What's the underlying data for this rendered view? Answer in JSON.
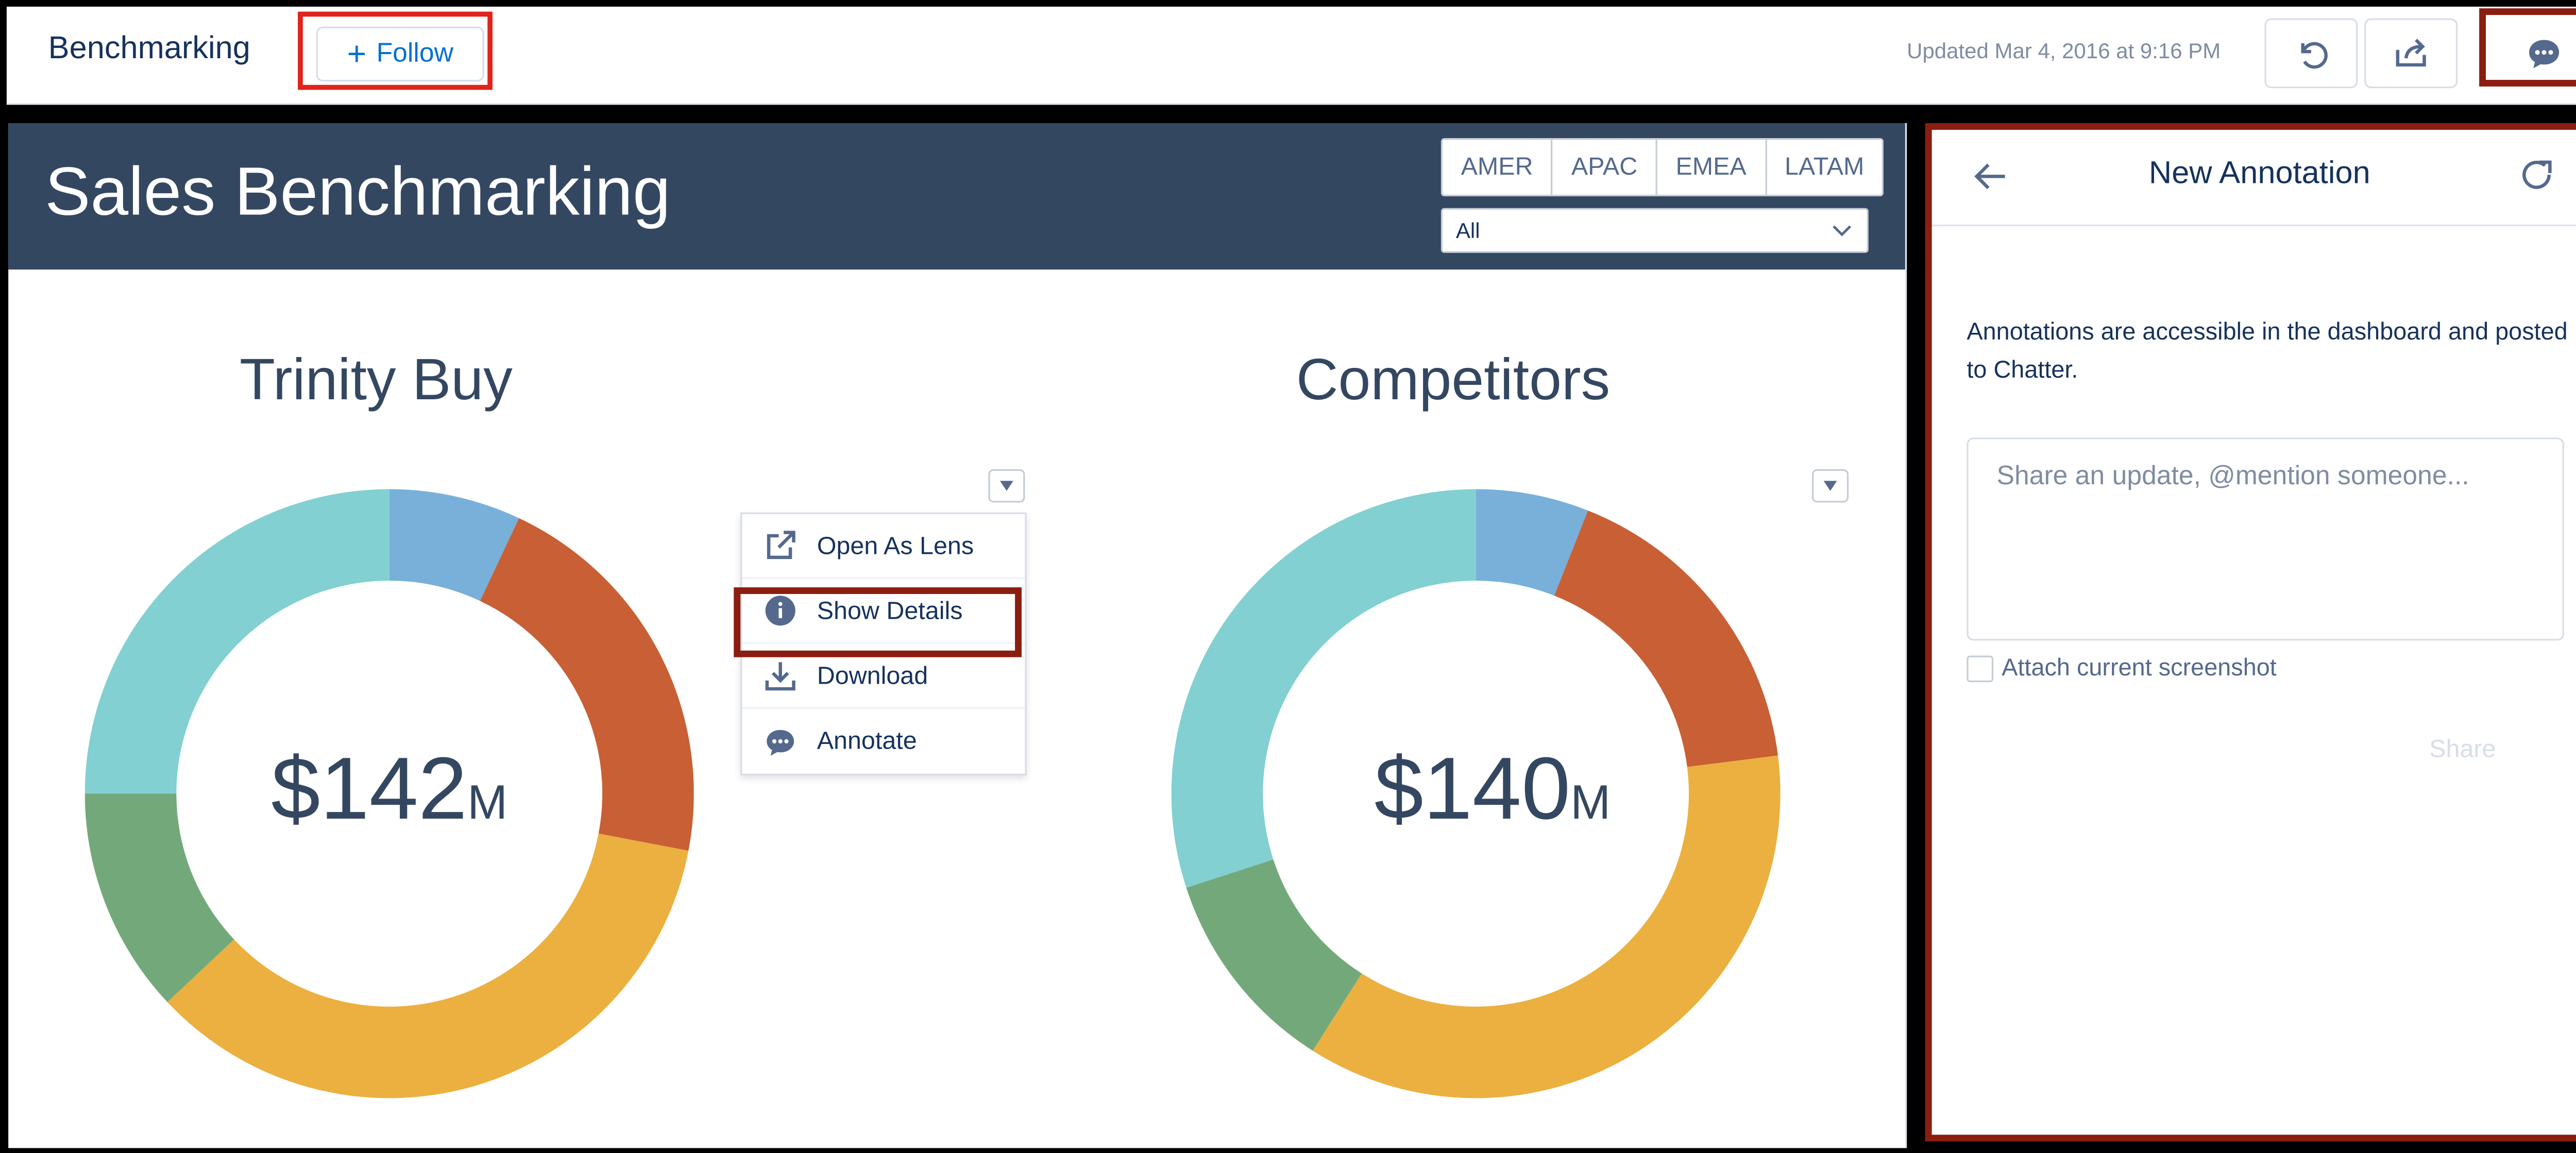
{
  "header": {
    "app_title": "Benchmarking",
    "follow_label": "Follow",
    "updated_text": "Updated Mar 4, 2016 at 9:16 PM",
    "icons": [
      "undo-icon",
      "share-icon",
      "annotation-icon"
    ]
  },
  "dashboard": {
    "title": "Sales Benchmarking",
    "region_tabs": [
      "AMER",
      "APAC",
      "EMEA",
      "LATAM"
    ],
    "region_select_value": "All"
  },
  "charts": [
    {
      "title": "Trinity Buy",
      "center_value": "$142",
      "center_unit": "M"
    },
    {
      "title": "Competitors",
      "center_value": "$140",
      "center_unit": "M"
    }
  ],
  "context_menu": {
    "items": [
      {
        "label": "Open As Lens",
        "icon": "external-link-icon"
      },
      {
        "label": "Show Details",
        "icon": "info-icon"
      },
      {
        "label": "Download",
        "icon": "download-icon"
      },
      {
        "label": "Annotate",
        "icon": "annotation-icon"
      }
    ]
  },
  "annotation_panel": {
    "title": "New Annotation",
    "description": "Annotations are accessible in the dashboard and posted to Chatter.",
    "placeholder": "Share an update, @mention someone...",
    "attach_label": "Attach current screenshot",
    "share_label": "Share"
  },
  "colors": {
    "banner": "#344761",
    "highlight_red": "#e0231b",
    "highlight_dark_red": "#8b1e10",
    "segment_blue": "#78b0da",
    "segment_orange": "#c95f34",
    "segment_yellow": "#ebb040",
    "segment_green": "#73a97a",
    "segment_teal": "#82d0d1"
  },
  "chart_data": [
    {
      "type": "pie",
      "title": "Trinity Buy",
      "donut": true,
      "center_label": "$142M",
      "categories": [
        "Blue",
        "Orange",
        "Yellow",
        "Green",
        "Teal"
      ],
      "values": [
        7,
        21,
        35,
        12,
        25
      ],
      "colors": [
        "#78b0da",
        "#c95f34",
        "#ebb040",
        "#73a97a",
        "#82d0d1"
      ]
    },
    {
      "type": "pie",
      "title": "Competitors",
      "donut": true,
      "center_label": "$140M",
      "categories": [
        "Blue",
        "Orange",
        "Yellow",
        "Green",
        "Teal"
      ],
      "values": [
        6,
        17,
        36,
        11,
        30
      ],
      "colors": [
        "#78b0da",
        "#c95f34",
        "#ebb040",
        "#73a97a",
        "#82d0d1"
      ]
    }
  ]
}
